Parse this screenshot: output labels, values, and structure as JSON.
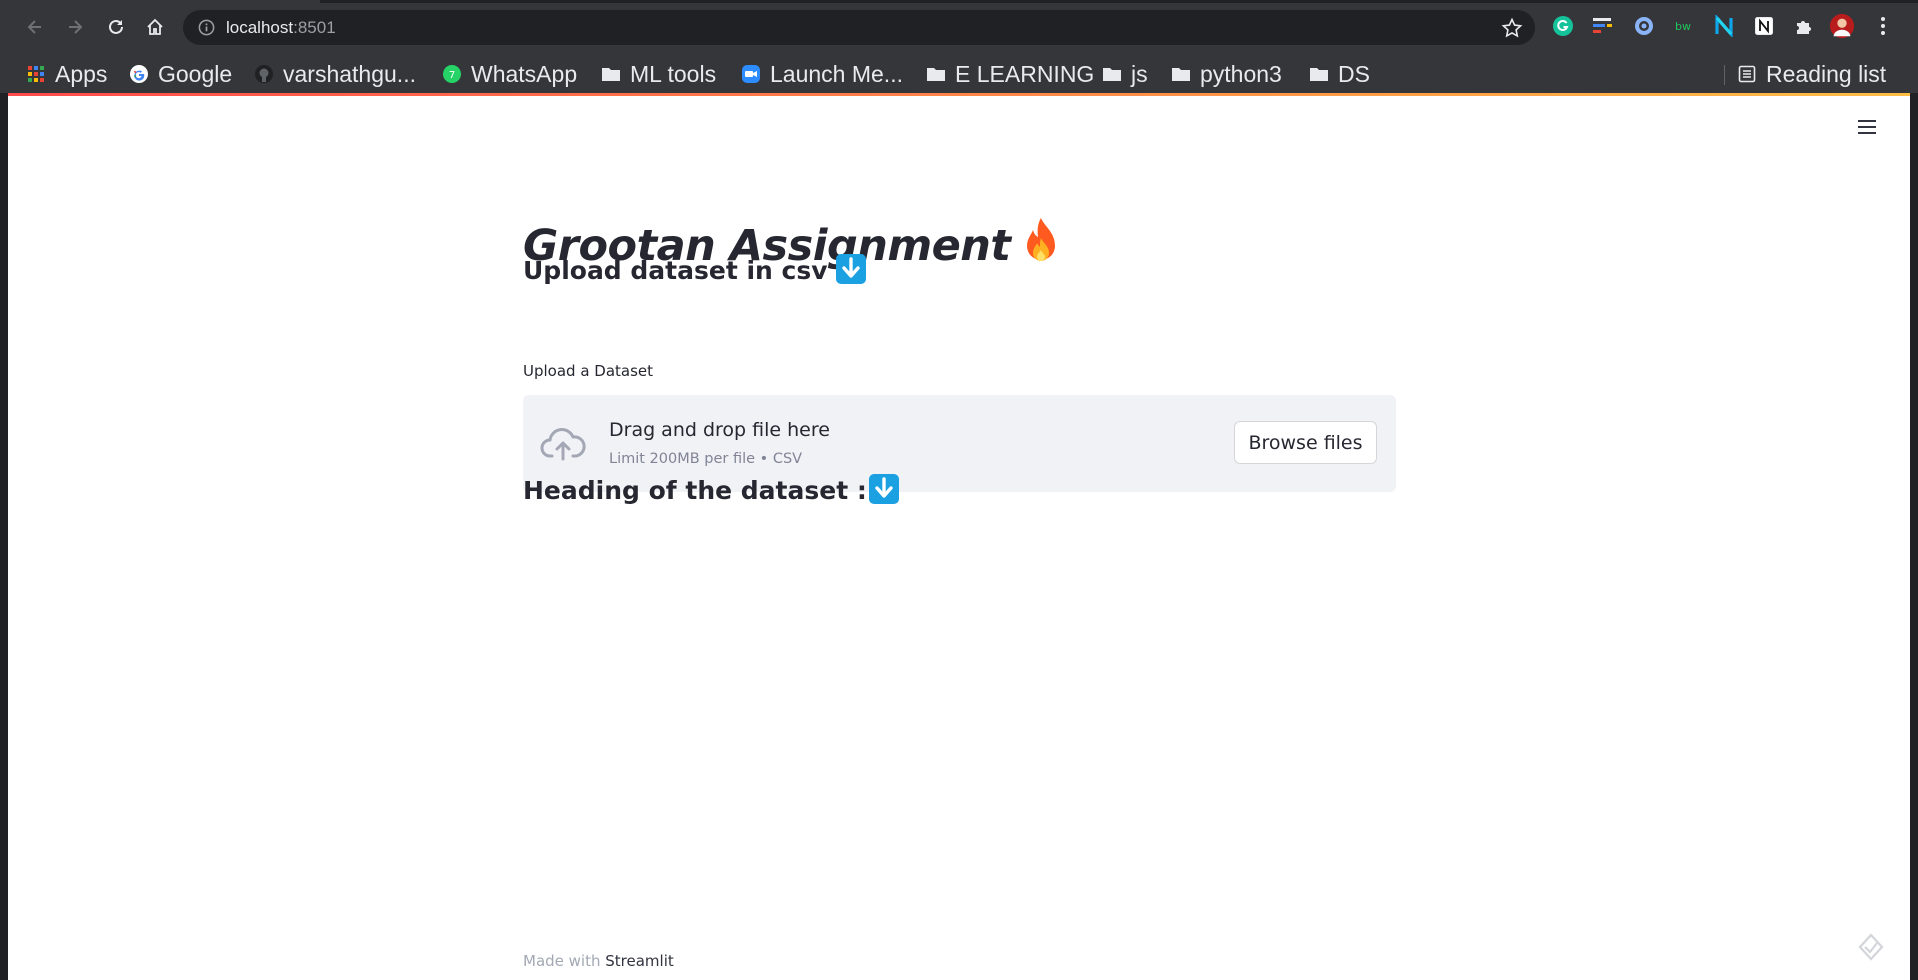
{
  "browser": {
    "url_host": "localhost",
    "url_port": ":8501",
    "bookmarks": [
      {
        "label": "Apps",
        "icon": "apps-grid-icon"
      },
      {
        "label": "Google",
        "icon": "google-icon"
      },
      {
        "label": "varshathgu...",
        "icon": "github-icon"
      },
      {
        "label": "WhatsApp",
        "icon": "whatsapp-icon"
      },
      {
        "label": "ML tools",
        "icon": "folder-icon"
      },
      {
        "label": "Launch Me...",
        "icon": "zoom-icon"
      },
      {
        "label": "E LEARNING",
        "icon": "folder-icon"
      },
      {
        "label": "js",
        "icon": "folder-icon"
      },
      {
        "label": "python3",
        "icon": "folder-icon"
      },
      {
        "label": "DS",
        "icon": "folder-icon"
      }
    ],
    "reading_list": "Reading list",
    "extensions": [
      "grammarly-icon",
      "extension-bars-icon",
      "extension-ring-icon",
      "extension-bw-icon",
      "extension-n-icon",
      "notion-icon",
      "puzzle-icon",
      "profile-avatar",
      "menu-dots-icon"
    ]
  },
  "app": {
    "title": "Grootan Assignment",
    "title_emoji": "🔥",
    "upload_header": "Upload dataset in csv",
    "uploader": {
      "label": "Upload a Dataset",
      "instructions": "Drag and drop file here",
      "limit": "Limit 200MB per file • CSV",
      "button": "Browse files"
    },
    "dataset_heading": "Heading of the dataset :",
    "footer_prefix": "Made with",
    "footer_brand": "Streamlit"
  },
  "colors": {
    "streamlit_accent": "#ff4b4b",
    "text": "#262730",
    "dropzone_bg": "#f0f2f6",
    "emoji_arrow_bg": "#1ba1e2"
  }
}
